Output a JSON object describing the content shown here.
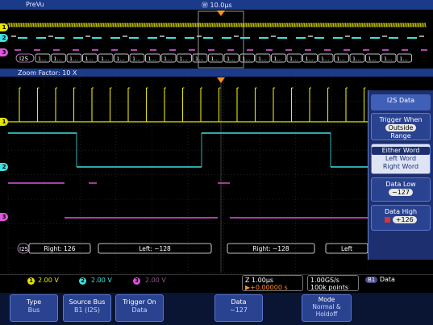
{
  "header": {
    "preview_label": "PreVu",
    "timebase_label": "Ⓦ 10.0µs"
  },
  "zoom": {
    "label": "Zoom Factor: 10 X"
  },
  "channels": [
    {
      "number": "1",
      "color": "#e6e600"
    },
    {
      "number": "2",
      "color": "#3fe0e0"
    },
    {
      "number": "3",
      "color": "#e055e0"
    }
  ],
  "bus": {
    "marker": "B1",
    "short_label": "I2S",
    "overview_symbol": "1...",
    "decode": [
      {
        "text": "Right: 126",
        "color": "#ffffff"
      },
      {
        "text": "Left: −128",
        "color": "#ffffff"
      },
      {
        "text": "Right: −128",
        "color": "#ffffff"
      },
      {
        "text": "Left",
        "color": "#ffffff"
      }
    ]
  },
  "side_menu": {
    "title": "I2S Data",
    "trigger_when_label": "Trigger When",
    "trigger_when_value": "Outside",
    "trigger_when_suffix": "Range",
    "word_options": [
      "Either Word",
      "Left Word",
      "Right Word"
    ],
    "data_low_label": "Data Low",
    "data_low_value": "−127",
    "data_high_label": "Data High",
    "data_high_value": "+126"
  },
  "status": {
    "ch1": "2.00 V",
    "ch2": "2.00 V",
    "ch3": "2.00 V",
    "zoom_timebase": "Z 1.00µs",
    "delay": "▶+0.00000 s",
    "sample_rate": "1.00GS/s",
    "record_length": "100k points",
    "trigger_source": "B1",
    "trigger_type": "Data"
  },
  "buttons": [
    {
      "label": "Type",
      "value": "Bus"
    },
    {
      "label": "Source Bus",
      "value": "B1 (I2S)"
    },
    {
      "label": "Trigger On",
      "value": "Data"
    },
    {
      "label": "Data",
      "value": "−127"
    },
    {
      "label": "Mode",
      "value": "Normal & Holdoff"
    }
  ],
  "colors": {
    "ch1": "#e6e600",
    "ch2": "#3fe0e0",
    "ch3": "#e055e0",
    "bus": "#ffffff",
    "menu": "#1d2f6e",
    "trigger": "#ff8c1a"
  }
}
